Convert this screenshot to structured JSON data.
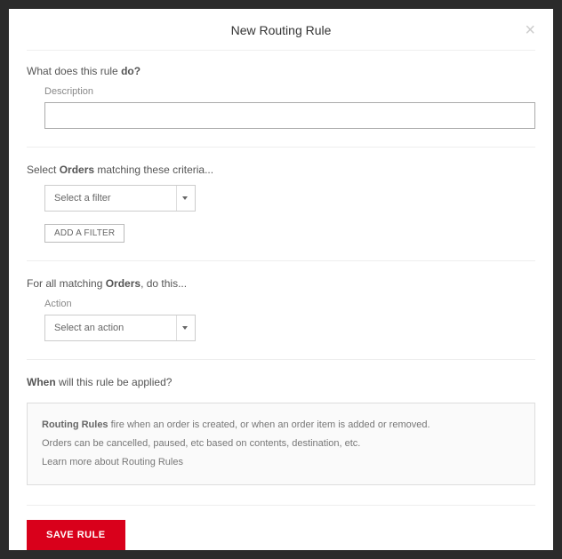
{
  "modal": {
    "title": "New Routing Rule"
  },
  "section1": {
    "question_prefix": "What does this rule ",
    "question_bold": "do?",
    "description_label": "Description"
  },
  "section2": {
    "prefix": "Select ",
    "bold": "Orders",
    "suffix": " matching these criteria...",
    "filter_placeholder": "Select a filter",
    "add_filter_label": "ADD A FILTER"
  },
  "section3": {
    "prefix": "For all matching ",
    "bold": "Orders",
    "suffix": ", do this...",
    "action_label": "Action",
    "action_placeholder": "Select an action"
  },
  "section4": {
    "bold": "When",
    "suffix": " will this rule be applied?",
    "info_bold": "Routing Rules",
    "info_line1_suffix": " fire when an order is created, or when an order item is added or removed.",
    "info_line2": "Orders can be cancelled, paused, etc based on contents, destination, etc.",
    "info_link": "Learn more about Routing Rules"
  },
  "footer": {
    "save_label": "SAVE RULE"
  }
}
